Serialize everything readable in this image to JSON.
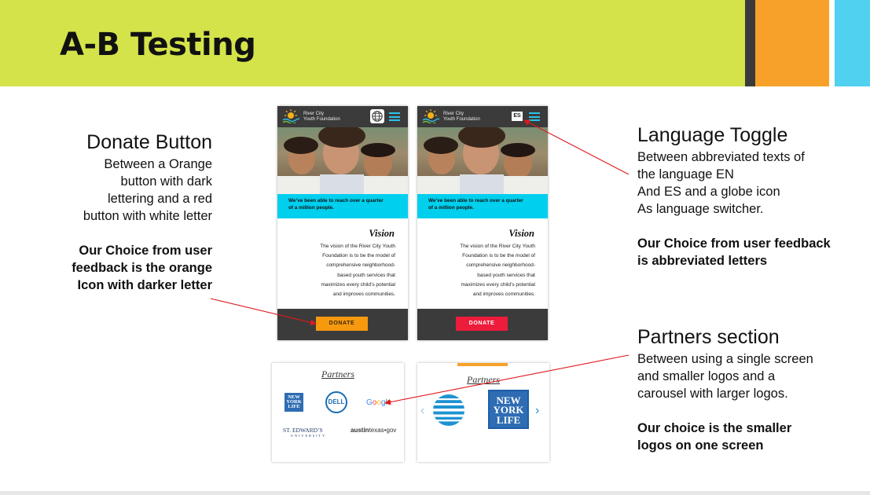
{
  "slide": {
    "title": "A-B Testing"
  },
  "colors": {
    "header_green": "#d4e34a",
    "accent_orange": "#f8a12a",
    "accent_blue": "#4fd1ef",
    "accent_dark": "#3a3a3a",
    "donate_orange": "#f7990f",
    "donate_red": "#ee1c3b",
    "banner_cyan": "#00cfee",
    "arrow_red": "#e0191d"
  },
  "donate_note": {
    "heading": "Donate Button",
    "lines": [
      "Between a Orange",
      "button with dark",
      "lettering and a red",
      "button with white letter"
    ],
    "choice_lines": [
      "Our Choice from user",
      "feedback is the orange",
      "Icon with darker letter"
    ]
  },
  "language_note": {
    "heading": "Language Toggle",
    "lines": [
      "Between abbreviated texts of",
      "the language EN",
      "And ES and a globe icon",
      "As language switcher."
    ],
    "choice_lines": [
      "Our Choice from user feedback",
      "is abbreviated letters"
    ]
  },
  "partners_note": {
    "heading": "Partners section",
    "lines": [
      "Between using a single screen",
      "and smaller logos and a",
      "carousel with larger logos."
    ],
    "choice_lines": [
      "Our choice is the smaller",
      "logos on one screen"
    ]
  },
  "phone": {
    "org_line1": "River City",
    "org_line2": "Youth Foundation",
    "banner_line1": "We’ve been able to reach over a quarter",
    "banner_line2": "of a million people.",
    "vision_title": "Vision",
    "vision_lines": [
      "The vision of the River City Youth",
      "Foundation is to be the model of",
      "comprehensive neighborhood-",
      "based youth services that",
      "maximizes every child’s potential",
      "and improves communities."
    ],
    "donate_label": "DONATE",
    "es_label": "ES",
    "globe_icon": "globe-icon",
    "menu_icon": "hamburger-menu-icon"
  },
  "partners": {
    "title": "Partners",
    "nyl_lines": [
      "NEW",
      "YORK",
      "LIFE"
    ],
    "dell_label": "DELL",
    "google_letters": [
      "G",
      "o",
      "o",
      "g",
      "l",
      "e"
    ],
    "google_colors": [
      "#4285f4",
      "#ea4335",
      "#fbbc05",
      "#4285f4",
      "#34a853",
      "#ea4335"
    ],
    "st_edwards_main": "ST. EDWARD’S",
    "st_edwards_sub": "UNIVERSITY",
    "austin_bold": "austin",
    "austin_rest": "texas",
    "austin_gov": "•gov",
    "carousel_prev": "‹",
    "carousel_next": "›"
  }
}
